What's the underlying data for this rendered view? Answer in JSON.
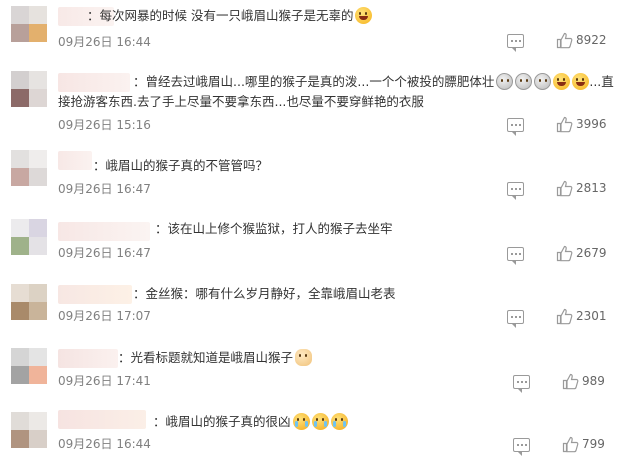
{
  "comments": [
    {
      "text": "：每次网暴的时候 没有一只峨眉山猴子是无辜的",
      "emojis": [
        "laugh"
      ],
      "time": "09月26日 16:44",
      "likes": "8922"
    },
    {
      "text": "：曾经去过峨眉山...哪里的猴子是真的泼...一个个被投的膘肥体壮",
      "emojis": [
        "grey",
        "grey",
        "grey",
        "laugh",
        "laugh"
      ],
      "text_cont": "...直",
      "text2": "接抢游客东西.去了手上尽量不要拿东西...也尽量不要穿鲜艳的衣服",
      "time": "09月26日 15:16",
      "likes": "3996"
    },
    {
      "text": "：峨眉山的猴子真的不管管吗？",
      "emojis": [],
      "time": "09月26日 16:47",
      "likes": "2813"
    },
    {
      "text": "：该在山上修个猴监狱，打人的猴子去坐牢",
      "emojis": [],
      "time": "09月26日 16:47",
      "likes": "2679"
    },
    {
      "text": "：金丝猴：哪有什么岁月静好，全靠峨眉山老表",
      "emojis": [],
      "time": "09月26日 17:07",
      "likes": "2301"
    },
    {
      "text": "：光看标题就知道是峨眉山猴子",
      "emojis": [
        "dog"
      ],
      "time": "09月26日 17:41",
      "likes": "989"
    },
    {
      "text": "：峨眉山的猴子真的很凶",
      "emojis": [
        "cry",
        "cry",
        "cry"
      ],
      "time": "09月26日 16:44",
      "likes": "799"
    }
  ],
  "colors": {
    "time": "#808080",
    "text": "#333333",
    "icon": "#9a9a9a"
  },
  "icons": {
    "reply": "comment-icon",
    "like": "thumbs-up-icon"
  }
}
